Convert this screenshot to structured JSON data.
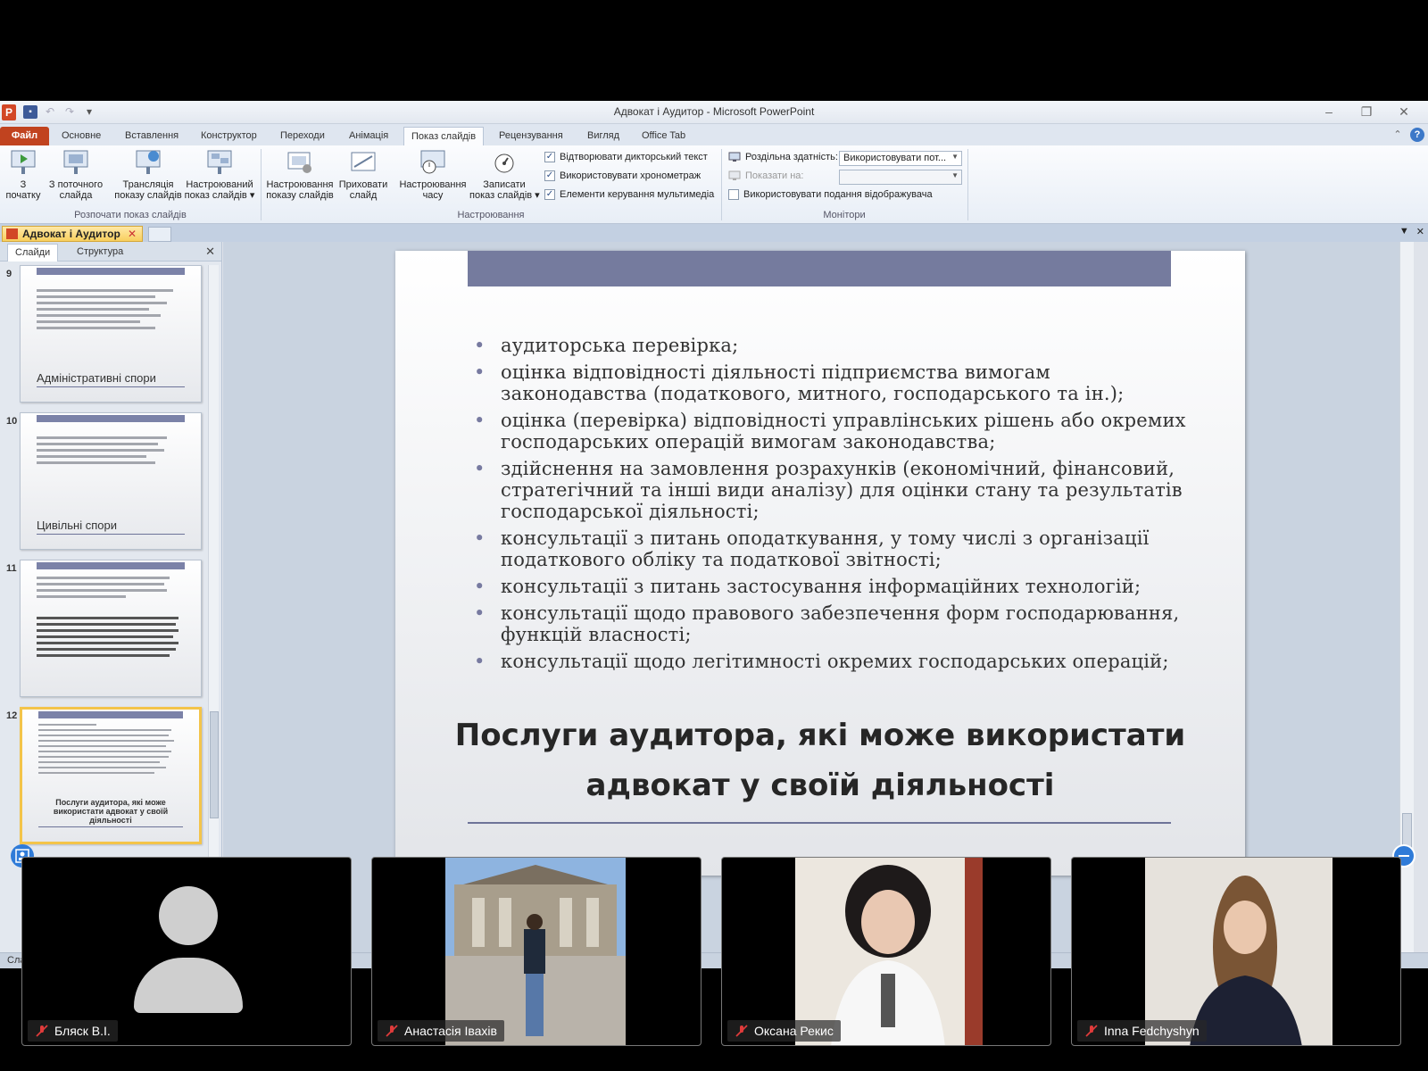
{
  "app": {
    "window_title": "Адвокат і Аудитор  -  Microsoft PowerPoint"
  },
  "ribbon_tabs": [
    "Файл",
    "Основне",
    "Вставлення",
    "Конструктор",
    "Переходи",
    "Анімація",
    "Показ слайдів",
    "Рецензування",
    "Вигляд",
    "Office Tab"
  ],
  "ribbon": {
    "from_start": "З\nпочатку",
    "from_current": "З поточного\nслайда",
    "broadcast": "Трансляція\nпоказу слайдів",
    "custom_show": "Настроюваний\nпоказ слайдів ▾",
    "group_start": "Розпочати показ слайдів",
    "setup_show": "Настроювання\nпоказу слайдів",
    "hide_slide": "Приховати\nслайд",
    "rehearse": "Настроювання\nчасу",
    "record": "Записати\nпоказ слайдів ▾",
    "chk_narration": "Відтворювати дикторський текст",
    "chk_timings": "Використовувати хронометраж",
    "chk_media": "Елементи керування мультимедіа",
    "group_setup": "Настроювання",
    "resolution_label": "Роздільна здатність:",
    "resolution_value": "Використовувати пот...",
    "show_on_label": "Показати на:",
    "show_on_value": "",
    "chk_presenter": "Використовувати подання відображувача",
    "group_monitors": "Монітори"
  },
  "doc_tab": "Адвокат і Аудитор",
  "panel": {
    "tab_slides": "Слайди",
    "tab_outline": "Структура"
  },
  "thumbnails": [
    {
      "num": "9",
      "title": "Адміністративні спори"
    },
    {
      "num": "10",
      "title": "Цивільні спори"
    },
    {
      "num": "11",
      "title": ""
    },
    {
      "num": "12",
      "title": "Послуги аудитора, які може використати адвокат у своїй діяльності"
    }
  ],
  "slide": {
    "bullets": [
      "аудиторська перевірка;",
      "оцінка відповідності діяльності підприємства вимогам законодавства (податкового, митного, господарського та ін.);",
      "оцінка (перевірка) відповідності управлінських рішень або окремих господарських операцій вимогам законодавства;",
      "здійснення на замовлення розрахунків (економічний, фінансовий, стратегічний та інші види аналізу) для оцінки стану та результатів господарської діяльності;",
      "консультації з питань оподаткування, у тому числі з організації податкового обліку та податкової звітності;",
      "консультації з питань застосування інформаційних технологій;",
      "консультації щодо правового забезпечення форм господарювання, функцій власності;",
      "консультації щодо легітимності окремих господарських операцій;"
    ],
    "title": "Послуги аудитора, які може використати адвокат у своїй діяльності"
  },
  "status": {
    "text": "Сла"
  },
  "participants": [
    {
      "name": "Бляск В.І."
    },
    {
      "name": "Анастасія Івахів"
    },
    {
      "name": "Оксана Рекис"
    },
    {
      "name": "Inna Fedchyshyn"
    }
  ],
  "colors": {
    "accent_file_tab": "#c1431f",
    "slide_bar": "#757b9e",
    "selected_thumb": "#f3c44a"
  }
}
